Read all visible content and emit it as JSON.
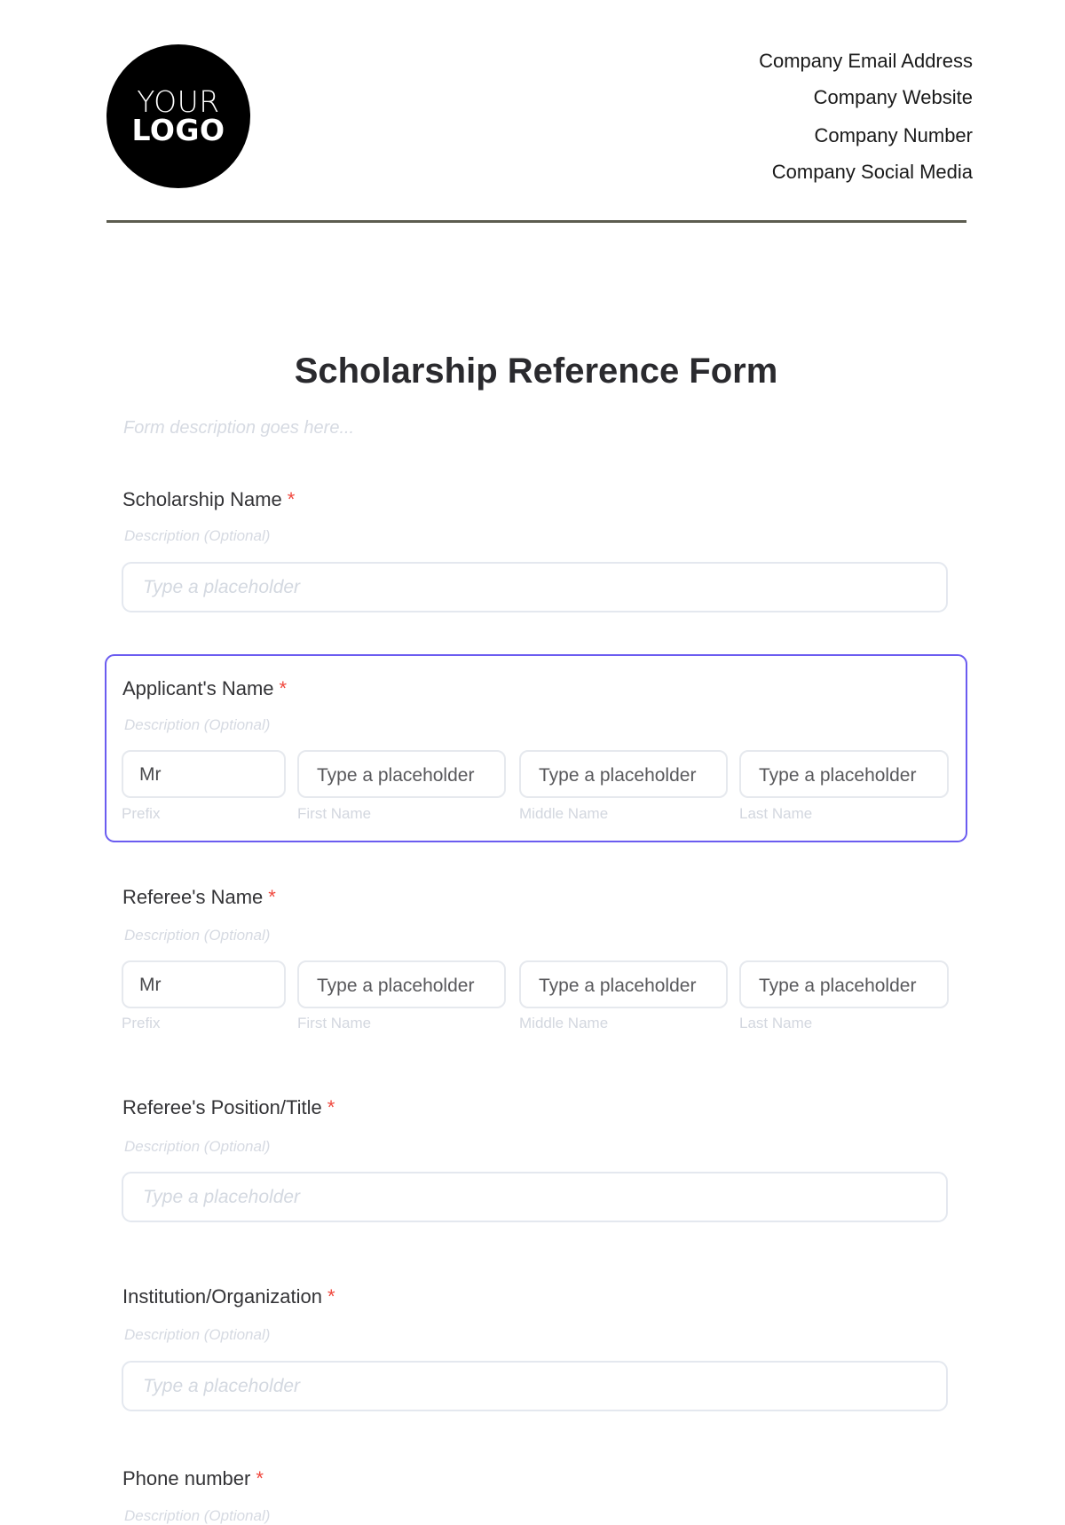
{
  "header": {
    "logo": {
      "line1": "YOUR",
      "line2": "LOGO"
    },
    "contact": [
      "Company Email Address",
      "Company Website",
      "Company Number",
      "Company Social Media"
    ]
  },
  "form": {
    "title": "Scholarship Reference Form",
    "description_placeholder": "Form description goes here...",
    "required_marker": "*",
    "colors": {
      "accent_focus": "#6b5cf0",
      "required": "#f0483e",
      "rule": "#5c5c4f"
    },
    "fields": [
      {
        "label": "Scholarship Name",
        "description": "Description (Optional)",
        "placeholder": "Type a placeholder"
      },
      {
        "label": "Applicant's Name",
        "description": "Description (Optional)",
        "focused": true,
        "parts": [
          {
            "value": "Mr",
            "sublabel": "Prefix"
          },
          {
            "placeholder": "Type a placeholder",
            "sublabel": "First Name"
          },
          {
            "placeholder": "Type a placeholder",
            "sublabel": "Middle Name"
          },
          {
            "placeholder": "Type a placeholder",
            "sublabel": "Last Name"
          }
        ]
      },
      {
        "label": "Referee's Name",
        "description": "Description (Optional)",
        "parts": [
          {
            "value": "Mr",
            "sublabel": "Prefix"
          },
          {
            "placeholder": "Type a placeholder",
            "sublabel": "First Name"
          },
          {
            "placeholder": "Type a placeholder",
            "sublabel": "Middle Name"
          },
          {
            "placeholder": "Type a placeholder",
            "sublabel": "Last Name"
          }
        ]
      },
      {
        "label": "Referee's Position/Title",
        "description": "Description (Optional)",
        "placeholder": "Type a placeholder"
      },
      {
        "label": "Institution/Organization",
        "description": "Description (Optional)",
        "placeholder": "Type a placeholder"
      },
      {
        "label": "Phone number",
        "description": "Description (Optional)"
      }
    ]
  }
}
